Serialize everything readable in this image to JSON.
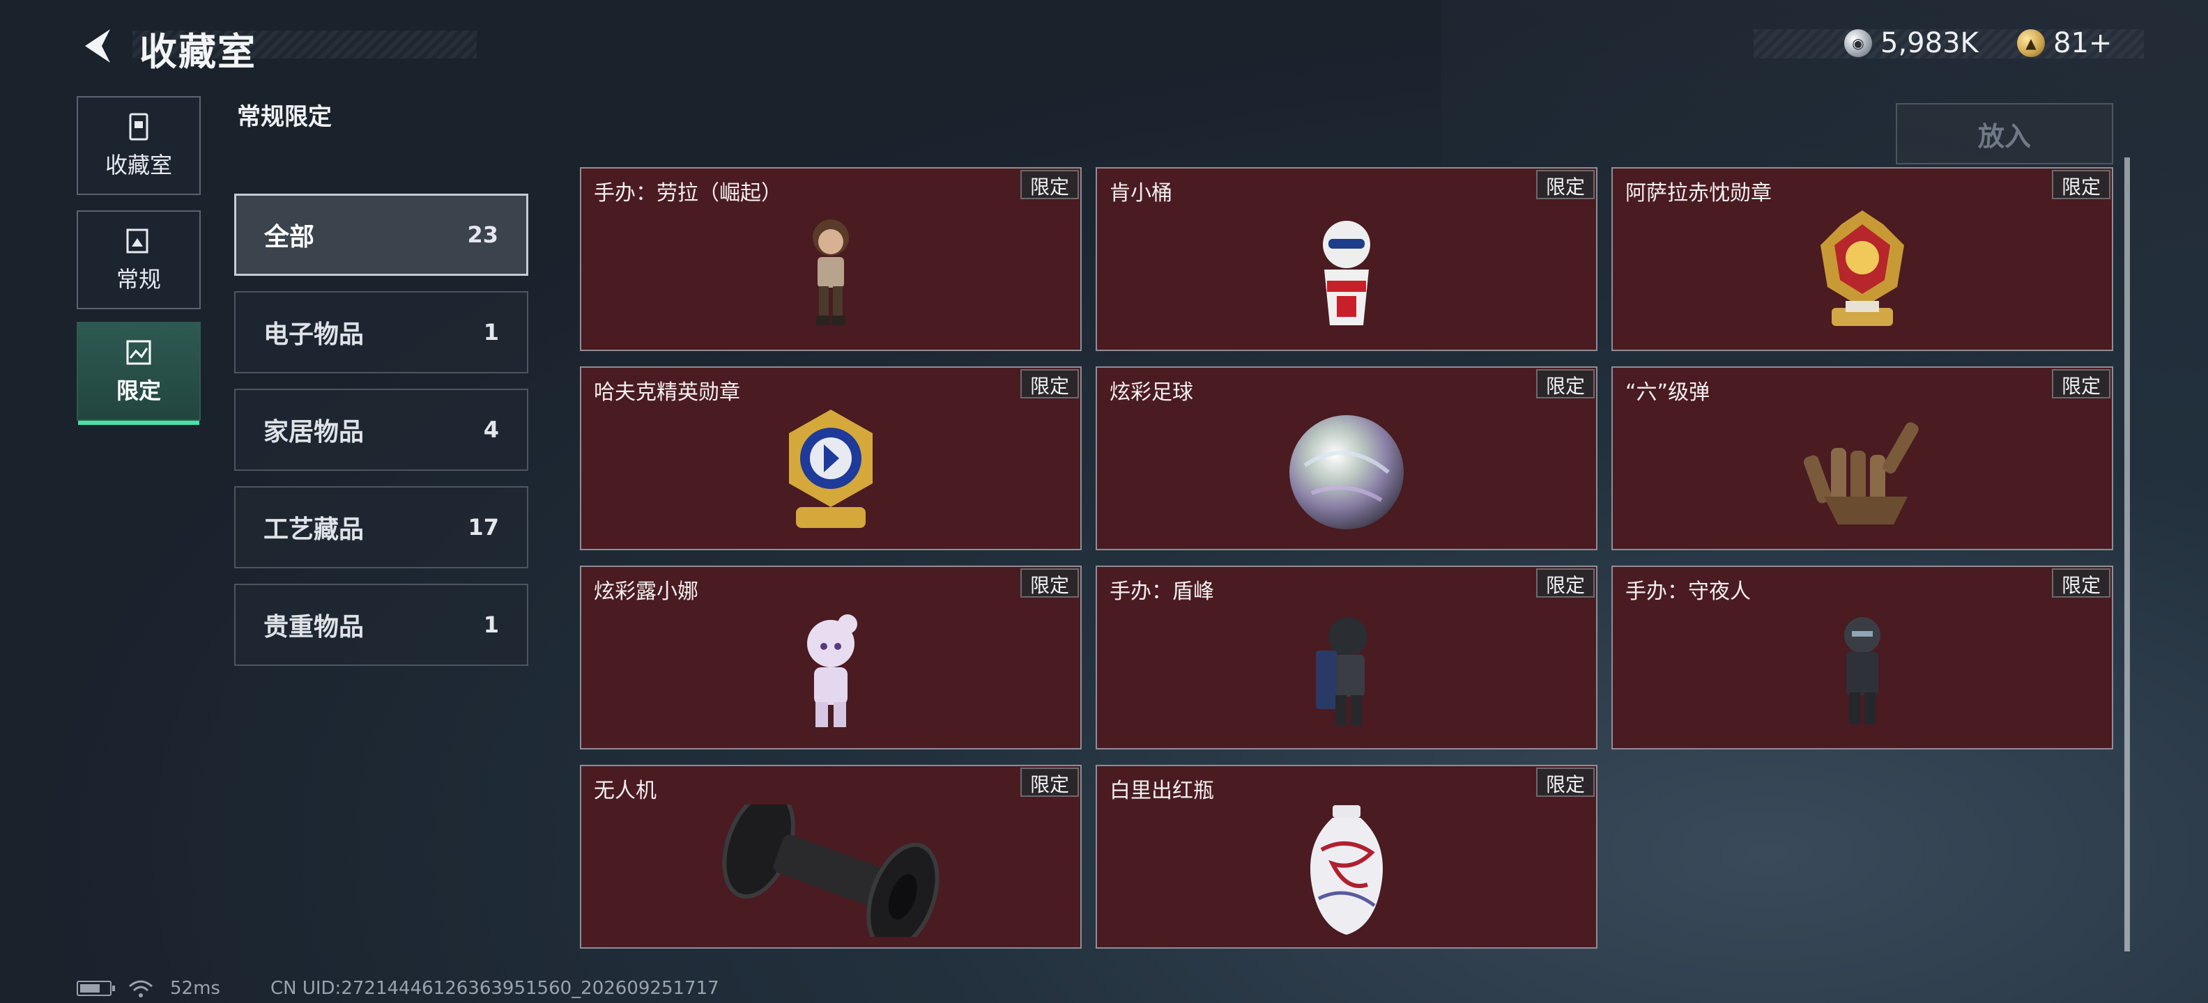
{
  "header": {
    "title": "收藏室",
    "currencies": [
      {
        "icon": "silver-coin-icon",
        "value": "5,983K"
      },
      {
        "icon": "gold-coin-icon",
        "value": "81+"
      }
    ]
  },
  "rail": [
    {
      "label": "收藏室",
      "icon": "collection-room-icon",
      "active": false
    },
    {
      "label": "常规",
      "icon": "regular-icon",
      "active": false
    },
    {
      "label": "限定",
      "icon": "limited-icon",
      "active": true
    }
  ],
  "section_title": "常规限定",
  "put_button": "放入",
  "categories": [
    {
      "name": "全部",
      "count": "23",
      "active": true
    },
    {
      "name": "电子物品",
      "count": "1"
    },
    {
      "name": "家居物品",
      "count": "4"
    },
    {
      "name": "工艺藏品",
      "count": "17"
    },
    {
      "name": "贵重物品",
      "count": "1"
    }
  ],
  "items": [
    {
      "name": "手办：劳拉（崛起）",
      "tag": "限定",
      "icon": "lara-figure-icon"
    },
    {
      "name": "肯小桶",
      "tag": "限定",
      "icon": "kfc-bucket-figure-icon"
    },
    {
      "name": "阿萨拉赤忱勋章",
      "tag": "限定",
      "icon": "medal-icon"
    },
    {
      "name": "哈夫克精英勋章",
      "tag": "限定",
      "icon": "elite-medal-icon"
    },
    {
      "name": "炫彩足球",
      "tag": "限定",
      "icon": "iridescent-ball-icon"
    },
    {
      "name": "“六”级弹",
      "tag": "限定",
      "icon": "bullet-hand-icon"
    },
    {
      "name": "炫彩露小娜",
      "tag": "限定",
      "icon": "luna-figure-icon"
    },
    {
      "name": "手办：盾峰",
      "tag": "限定",
      "icon": "shield-figure-icon"
    },
    {
      "name": "手办：守夜人",
      "tag": "限定",
      "icon": "nightwatch-figure-icon"
    },
    {
      "name": "无人机",
      "tag": "限定",
      "icon": "drone-icon"
    },
    {
      "name": "白里出红瓶",
      "tag": "限定",
      "icon": "vase-icon"
    }
  ],
  "footer": {
    "ping": "52ms",
    "uid": "CN UID:272144461263639515​60_202609251717"
  }
}
